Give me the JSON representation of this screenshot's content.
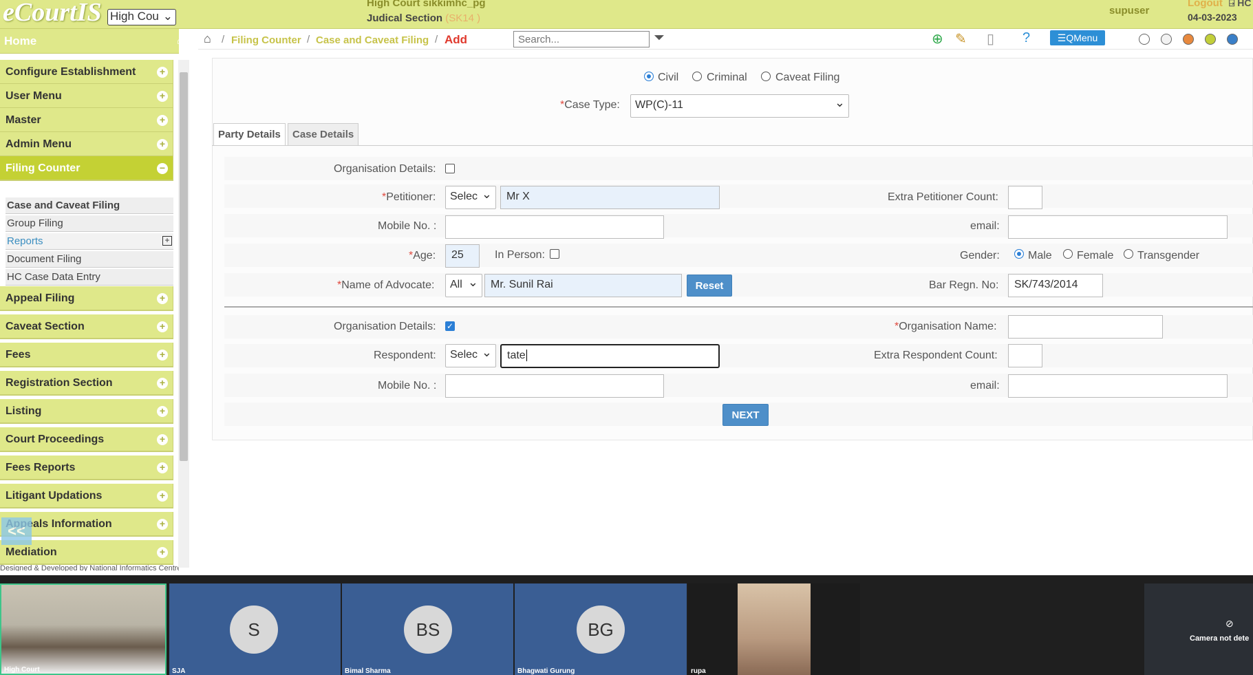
{
  "header": {
    "logo": "eCourtIS",
    "establishment": "High Cou",
    "court": "High Court sikkimhc_pg",
    "section_label": "Judical Section",
    "section_code": "(SK14 )",
    "user": "supuser",
    "logout": "Logout",
    "date": "04-03-2023",
    "hc": "HC"
  },
  "sidebar": {
    "home": "Home",
    "items": [
      {
        "label": "Configure Establishment"
      },
      {
        "label": "User Menu"
      },
      {
        "label": "Master"
      },
      {
        "label": "Admin Menu"
      },
      {
        "label": "Filing Counter"
      }
    ],
    "sub_items": [
      {
        "label": "Case and Caveat Filing"
      },
      {
        "label": "Group Filing"
      },
      {
        "label": "Reports"
      },
      {
        "label": "Document Filing"
      },
      {
        "label": "HC Case Data Entry"
      }
    ],
    "items2": [
      {
        "label": "Appeal Filing"
      },
      {
        "label": "Caveat Section"
      },
      {
        "label": "Fees"
      },
      {
        "label": "Registration Section"
      },
      {
        "label": "Listing"
      },
      {
        "label": "Court Proceedings"
      },
      {
        "label": "Fees Reports"
      },
      {
        "label": "Litigant Updations"
      },
      {
        "label": "Appeals Information"
      },
      {
        "label": "Mediation"
      }
    ],
    "collapse": "<<",
    "footer": "Designed & Developed by National Informatics Centre"
  },
  "breadcrumb": {
    "c1": "Filing Counter",
    "c2": "Case and Caveat Filing",
    "c3": "Add",
    "search_placeholder": "Search...",
    "qmenu": "☰QMenu"
  },
  "form": {
    "filing_types": [
      "Civil",
      "Criminal",
      "Caveat Filing"
    ],
    "case_type_label": "Case Type:",
    "case_type_value": "WP(C)-11",
    "tabs": [
      "Party Details",
      "Case Details"
    ],
    "org_details": "Organisation Details:",
    "petitioner_label": "Petitioner:",
    "petitioner_select": "Selec",
    "petitioner_value": "Mr X",
    "extra_pet_label": "Extra Petitioner Count:",
    "mobile_label": "Mobile No. :",
    "email_label": "email:",
    "age_label": "Age:",
    "age_value": "25",
    "in_person": "In Person:",
    "gender_label": "Gender:",
    "genders": [
      "Male",
      "Female",
      "Transgender"
    ],
    "advocate_label": "Name of Advocate:",
    "advocate_select": "All",
    "advocate_value": "Mr. Sunil Rai",
    "reset": "Reset",
    "bar_label": "Bar Regn. No:",
    "bar_value": "SK/743/2014",
    "org_name_label": "Organisation Name:",
    "respondent_label": "Respondent:",
    "respondent_select": "Selec",
    "respondent_value": "tate",
    "extra_resp_label": "Extra Respondent Count:",
    "next": "NEXT"
  },
  "meeting": {
    "tiles": [
      {
        "name": "High Court"
      },
      {
        "initials": "S",
        "name": "SJA"
      },
      {
        "initials": "BS",
        "name": "Bimal Sharma"
      },
      {
        "initials": "BG",
        "name": "Bhagwati Gurung"
      },
      {
        "name": "rupa"
      }
    ],
    "camera": "Camera not dete"
  }
}
